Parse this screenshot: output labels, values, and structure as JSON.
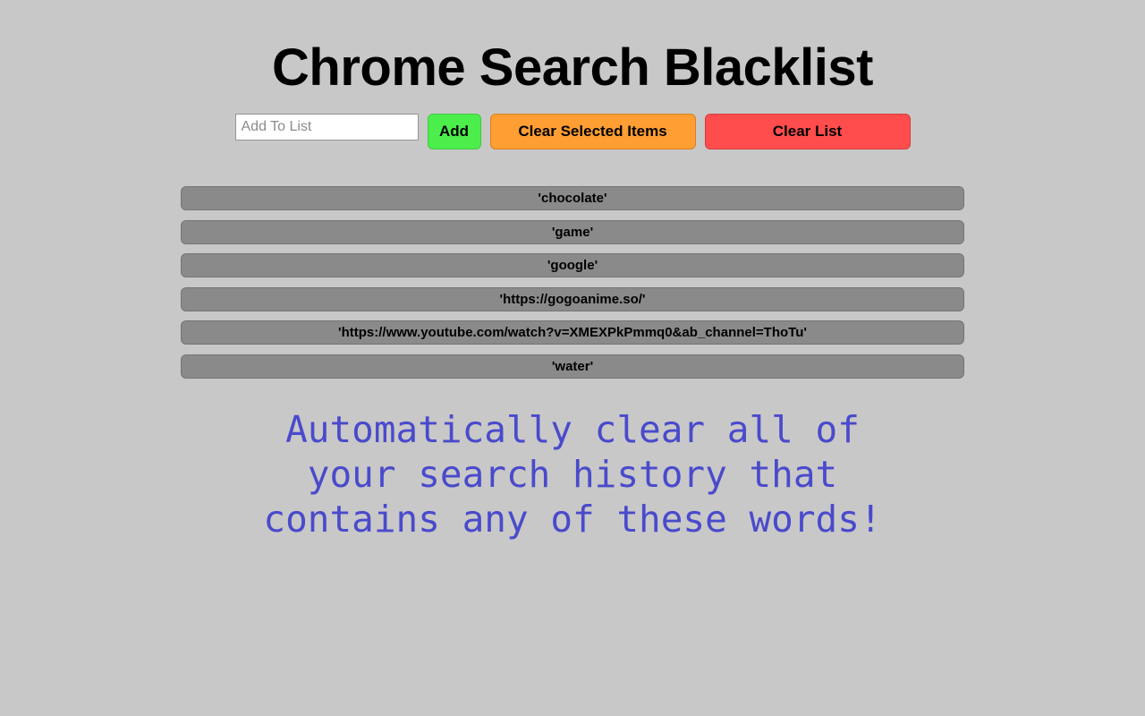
{
  "page": {
    "title": "Chrome Search Blacklist",
    "background_color": "#c8c8c8"
  },
  "toolbar": {
    "input_placeholder": "Add To List",
    "input_value": "",
    "add_label": "Add",
    "clear_selected_label": "Clear Selected Items",
    "clear_list_label": "Clear List",
    "add_color": "#4cee4c",
    "clear_selected_color": "#ff9e33",
    "clear_list_color": "#ff4d4d"
  },
  "blacklist": {
    "item_color": "#8a8a8a",
    "items": [
      {
        "label": "'chocolate'"
      },
      {
        "label": "'game'"
      },
      {
        "label": "'google'"
      },
      {
        "label": "'https://gogoanime.so/'"
      },
      {
        "label": "'https://www.youtube.com/watch?v=XMEXPkPmmq0&ab_channel=ThoTu'"
      },
      {
        "label": "'water'"
      }
    ]
  },
  "tagline": {
    "text": "Automatically clear all of your search history that contains any of these words!",
    "color": "#4a4acc"
  }
}
